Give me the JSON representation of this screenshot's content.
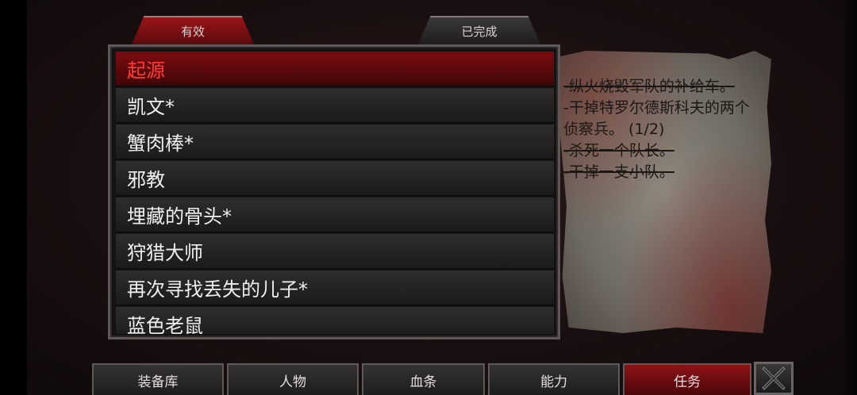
{
  "tabs": {
    "active": "有效",
    "completed": "已完成"
  },
  "quests": [
    {
      "title": "起源",
      "selected": true
    },
    {
      "title": "凯文*"
    },
    {
      "title": "蟹肉棒*"
    },
    {
      "title": "邪教"
    },
    {
      "title": "埋藏的骨头*"
    },
    {
      "title": "狩猎大师"
    },
    {
      "title": "再次寻找丢失的儿子*"
    },
    {
      "title": "蓝色老鼠"
    }
  ],
  "objectives": [
    {
      "text": "-纵火烧毁军队的补给车。",
      "done": true
    },
    {
      "text": "-干掉特罗尔德斯科夫的两个侦察兵。 (1/2)",
      "done": false
    },
    {
      "text": "-杀死一个队长。",
      "done": true
    },
    {
      "text": "-干掉一支小队。",
      "done": true
    }
  ],
  "nav": {
    "inventory": "装备库",
    "character": "人物",
    "bloodline": "血条",
    "abilities": "能力",
    "quests": "任务"
  },
  "icons": {
    "close": "close-icon"
  },
  "colors": {
    "accent_red": "#9a1518",
    "selected_text": "#ff3b3b"
  }
}
